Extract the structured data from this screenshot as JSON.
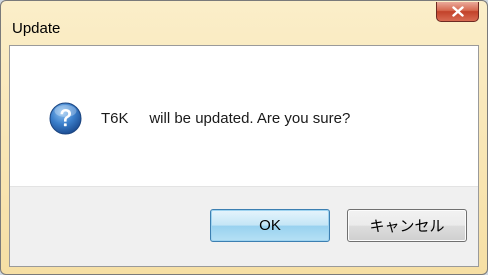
{
  "dialog": {
    "title": "Update",
    "close_icon": "close-icon",
    "message_icon": "question-icon",
    "message": "T6K     will be updated. Are you sure?",
    "buttons": {
      "ok_label": "OK",
      "cancel_label": "キャンセル"
    }
  },
  "colors": {
    "frame": "#f6dfa4",
    "close_button": "#c2412a",
    "ok_border": "#3c7fb1",
    "icon_blue": "#2f6fb6"
  }
}
